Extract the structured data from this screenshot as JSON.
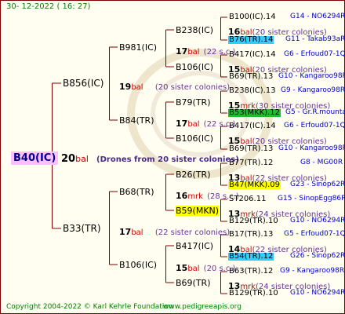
{
  "header": {
    "date": "30-  12-2022  ( 16:  27)"
  },
  "root": {
    "id": "B40(IC)",
    "count": "20",
    "unit": "bal",
    "note": "(Drones from 20 sister colonies)"
  },
  "gen1": {
    "upper": {
      "id": "B856(IC)",
      "count": "19",
      "unit": "bal",
      "note": "(20 sister colonies)"
    },
    "lower": {
      "id": "B33(TR)",
      "count": "17",
      "unit": "bal",
      "note": "(22 sister colonies)"
    }
  },
  "gen2": {
    "b981": {
      "id": "B981(IC)"
    },
    "b84": {
      "id": "B84(TR)",
      "count": "17",
      "unit": "bal",
      "note": "(22 s.c.)"
    },
    "b68": {
      "id": "B68(TR)",
      "count": "16",
      "unit": "mrk",
      "note": "(28 s.c.)"
    },
    "b106": {
      "id": "B106(IC)",
      "count": "15",
      "unit": "bal",
      "note": "(20 s.c.)"
    }
  },
  "gen3": [
    {
      "id": "B238(IC)",
      "count": "17",
      "unit": "bal",
      "note": "(22 s.c.)"
    },
    {
      "id": "B106(IC)",
      "count": "15",
      "unit": "bal",
      "note": "(20 s.c.)"
    },
    {
      "id": "B79(TR)",
      "count": "17",
      "unit": "bal",
      "note": "(22 s.c.)"
    },
    {
      "id": "B106(IC)"
    },
    {
      "id": "B26(TR)",
      "count": "13",
      "unit": "bal",
      "note": "(22 s.c.)"
    },
    {
      "id": "B59(MKN)"
    },
    {
      "id": "B417(IC)",
      "count": "15",
      "unit": "bal",
      "note": "(20 s.c.)"
    },
    {
      "id": "B69(TR)"
    }
  ],
  "gen4": [
    {
      "id": "B100(IC).14",
      "info": "G14 - NO6294R"
    },
    {
      "count": "16",
      "unit": "bal",
      "note": "(20 sister colonies)"
    },
    {
      "id": "B76(TR).14",
      "info": "G11 - Takab93aR"
    },
    {
      "id": "B417(IC).14",
      "info": "G6 - Erfoud07-1Q"
    },
    {
      "count": "15",
      "unit": "bal",
      "note": "(20 sister colonies)"
    },
    {
      "id": "B69(TR).13",
      "info": "G10 - Kangaroo98R"
    },
    {
      "id": "B238(IC).13",
      "info": "G9 - Kangaroo98R"
    },
    {
      "count": "15",
      "unit": "mrk",
      "note": "(30 sister colonies)"
    },
    {
      "id": "B53(MKK).12",
      "info": "G5 - Gr.R.mounta"
    },
    {
      "id": "B417(IC).14",
      "info": "G6 - Erfoud07-1Q"
    },
    {
      "count": "15",
      "unit": "bal",
      "note": "(20 sister colonies)"
    },
    {
      "id": "B69(TR).13",
      "info": "G10 - Kangaroo98R"
    },
    {
      "id": "B77(TR).12",
      "info": "G8 - MG00R"
    },
    {
      "count": "13",
      "unit": "bal",
      "note": "(22 sister colonies)"
    },
    {
      "id": "B47(MKK).09",
      "info": "G23 - Sinop62R"
    },
    {
      "id": "ST206.11",
      "info": "G15 - SinopEgg86R"
    },
    {
      "count": "13",
      "unit": "mrk",
      "note": "(24 sister colonies)"
    },
    {
      "id": "B129(TR).10",
      "info": "G10 - NO6294R"
    },
    {
      "id": "B17(TR).13",
      "info": "G5 - Erfoud07-1Q"
    },
    {
      "count": "14",
      "unit": "bal",
      "note": "(22 sister colonies)"
    },
    {
      "id": "B54(TR).12",
      "info": "G26 - Sinop62R"
    },
    {
      "id": "B63(TR).12",
      "info": "G9 - Kangaroo98R"
    },
    {
      "count": "13",
      "unit": "mrk",
      "note": "(24 sister colonies)"
    },
    {
      "id": "B129(TR).10",
      "info": "G10 - NO6294R"
    }
  ],
  "footer": {
    "copyright": "Copyright 2004-2022 © Karl Kehrle Foundation",
    "site": "www.pedigreeapis.org"
  },
  "colors": {
    "line": "#800000",
    "unit": "#cc0000",
    "note": "#663399",
    "info": "#0000cc",
    "date": "#008000",
    "root_bg": "#ffc0ff",
    "root_text": "#00008b",
    "cyan": "#33ccff",
    "green": "#22bb33",
    "yellow": "#ffff00"
  }
}
